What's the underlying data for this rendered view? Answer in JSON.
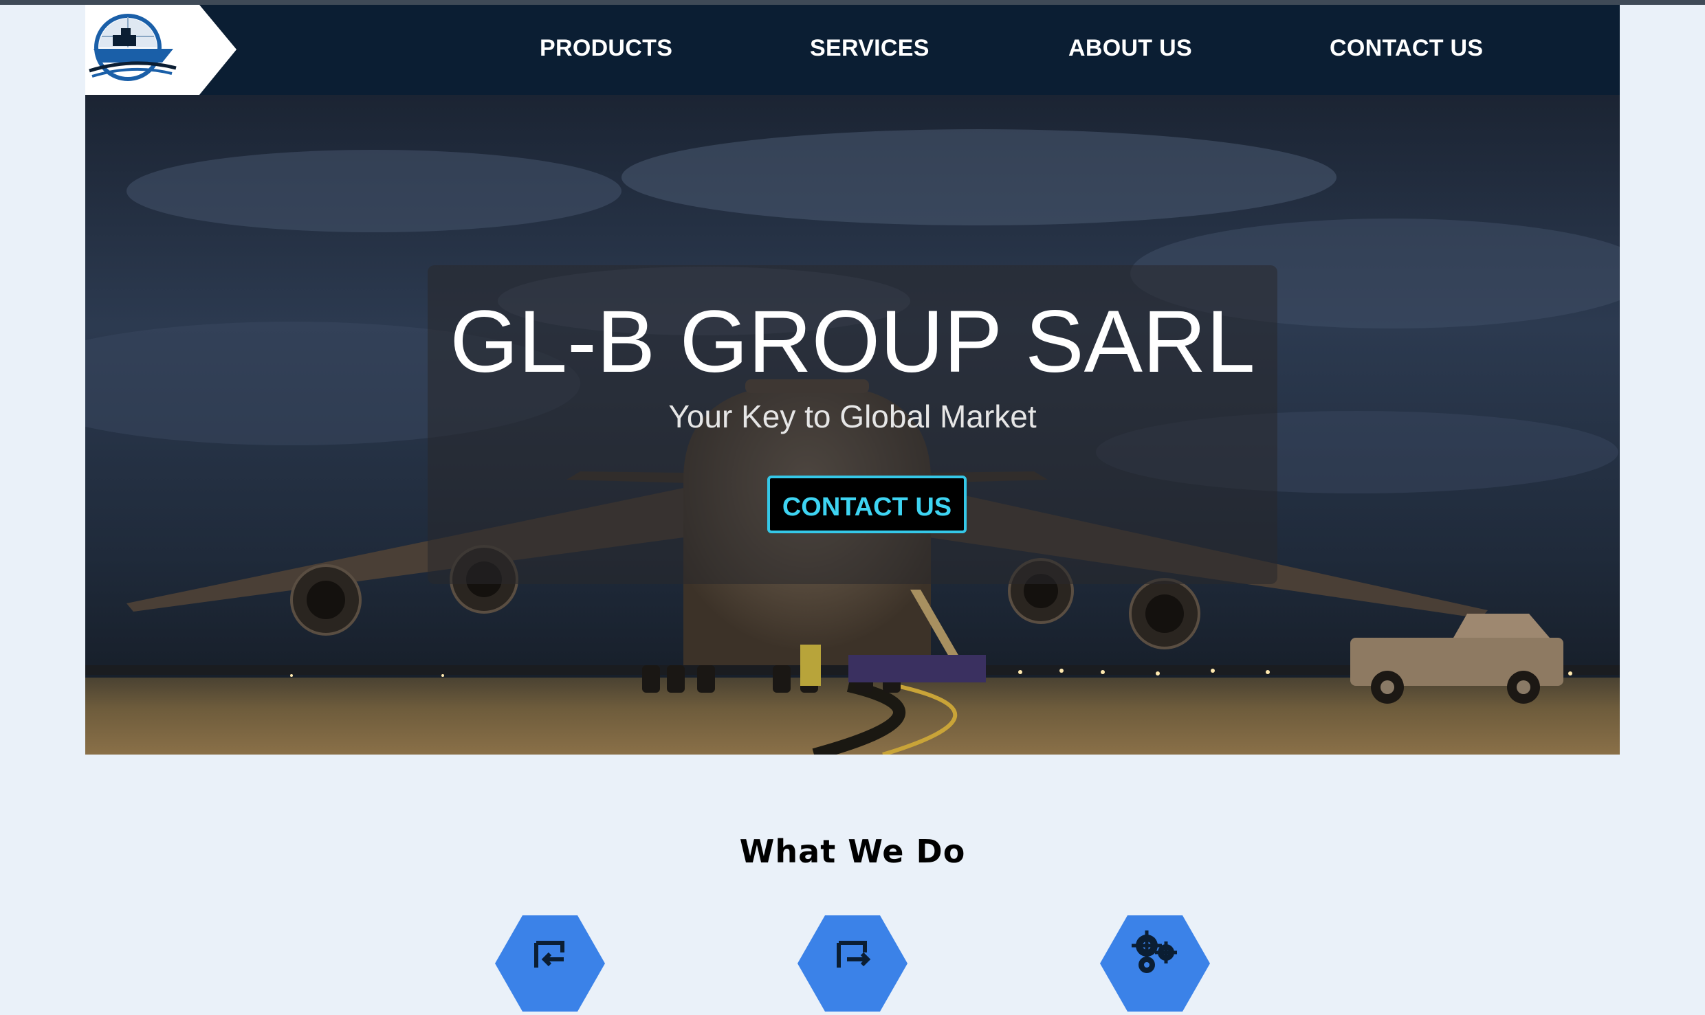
{
  "nav": {
    "logo_name": "ship-logo",
    "items": [
      {
        "label": "PRODUCTS"
      },
      {
        "label": "SERVICES"
      },
      {
        "label": "ABOUT US"
      },
      {
        "label": "CONTACT US"
      }
    ]
  },
  "hero": {
    "title": "GL-B GROUP SARL",
    "subtitle": "Your Key to Global Market",
    "cta_label": "CONTACT US"
  },
  "what_we_do": {
    "title": "What We Do",
    "icons": [
      "import-icon",
      "export-icon",
      "gears-icon"
    ]
  },
  "colors": {
    "nav_bg": "#0b1e33",
    "accent": "#35c8e8",
    "hex_blue": "#3b82e8",
    "page_bg": "#eaf1f9"
  }
}
